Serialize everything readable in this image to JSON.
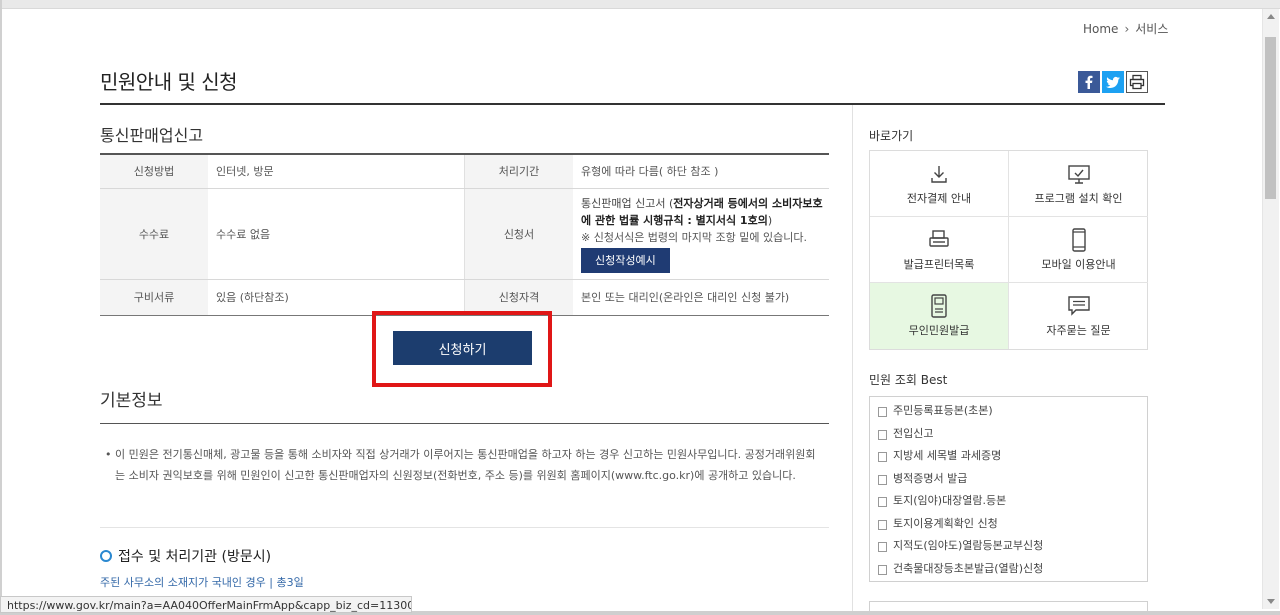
{
  "breadcrumb": {
    "home": "Home",
    "current": "서비스"
  },
  "page": {
    "title": "민원안내 및 신청"
  },
  "share": {
    "facebook_icon": "facebook-icon",
    "twitter_icon": "twitter-icon",
    "print_icon": "print-icon"
  },
  "service": {
    "title": "통신판매업신고",
    "rows": [
      {
        "h1": "신청방법",
        "v1": "인터넷, 방문",
        "h2": "처리기간",
        "v2": "유형에 따라 다름( 하단 참조 )"
      },
      {
        "h1": "수수료",
        "v1": "수수료 없음",
        "h2": "신청서",
        "doc_plain": "통신판매업 신고서 (",
        "doc_bold": "전자상거래 등에서의 소비자보호에 관한 법률 시행규칙 : 별지서식 1호의",
        "doc_end": ")",
        "doc_note": "※ 신청서식은 법령의 마지막 조항 밑에 있습니다.",
        "doc_button": "신청작성예시"
      },
      {
        "h1": "구비서류",
        "v1": "있음 (하단참조)",
        "h2": "신청자격",
        "v2": "본인 또는 대리인(온라인은 대리인 신청 불가)"
      }
    ]
  },
  "apply": {
    "label": "신청하기"
  },
  "basic": {
    "title": "기본정보",
    "text": "이 민원은 전기통신매체, 광고물 등을 통해 소비자와 직접 상거래가 이루어지는 통신판매업을 하고자 하는 경우 신고하는 민원사무입니다. 공정거래위원회는 소비자 권익보호를 위해 민원인이 신고한 통신판매업자의 신원정보(전화번호, 주소 등)를 위원회 홈페이지(www.ftc.go.kr)에 공개하고 있습니다."
  },
  "office": {
    "title": "접수 및 처리기관 (방문시)",
    "sub": "주된 사무소의 소재지가 국내인 경우 | 총3일"
  },
  "status_url": "https://www.gov.kr/main?a=AA040OfferMainFrmApp&capp_biz_cd=113000000...",
  "quick": {
    "title": "바로가기",
    "items": [
      {
        "label": "전자결제 안내",
        "icon": "download-icon"
      },
      {
        "label": "프로그램 설치 확인",
        "icon": "monitor-check-icon"
      },
      {
        "label": "발급프린터목록",
        "icon": "printer-icon"
      },
      {
        "label": "모바일 이용안내",
        "icon": "mobile-icon"
      },
      {
        "label": "무인민원발급",
        "icon": "kiosk-icon"
      },
      {
        "label": "자주묻는 질문",
        "icon": "speech-bubble-icon"
      }
    ]
  },
  "best": {
    "title": "민원 조회 Best",
    "items": [
      "주민등록표등본(초본)",
      "전입신고",
      "지방세 세목별 과세증명",
      "병적증명서 발급",
      "토지(임야)대장열람.등본",
      "토지이용계획확인 신청",
      "지적도(임야도)열람등본교부신청",
      "건축물대장등초본발급(열람)신청"
    ]
  },
  "colors": {
    "navy": "#1c3d6e",
    "highlight": "#e01616",
    "active_cell": "#e7f8e2",
    "link": "#3368a8"
  }
}
